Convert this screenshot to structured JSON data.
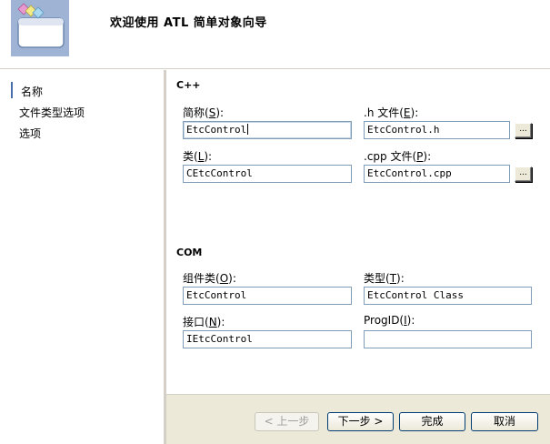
{
  "header": {
    "title": "欢迎使用 ATL 简单对象向导"
  },
  "nav": {
    "items": [
      {
        "label": "名称",
        "selected": true
      },
      {
        "label": "文件类型选项",
        "selected": false
      },
      {
        "label": "选项",
        "selected": false
      }
    ]
  },
  "cpp_group": {
    "label": "C++",
    "short_name": {
      "label_pre": "简称(",
      "hotkey": "S",
      "label_post": "):",
      "value": "EtcControl"
    },
    "h_file": {
      "label_pre": ".h 文件(",
      "hotkey": "E",
      "label_post": "):",
      "value": "EtcControl.h"
    },
    "class": {
      "label_pre": "类(",
      "hotkey": "L",
      "label_post": "):",
      "value": "CEtcControl"
    },
    "cpp_file": {
      "label_pre": ".cpp 文件(",
      "hotkey": "P",
      "label_post": "):",
      "value": "EtcControl.cpp"
    },
    "browse_label": "..."
  },
  "com_group": {
    "label": "COM",
    "coclass": {
      "label_pre": "组件类(",
      "hotkey": "O",
      "label_post": "):",
      "value": "EtcControl"
    },
    "type": {
      "label_pre": "类型(",
      "hotkey": "T",
      "label_post": "):",
      "value": "EtcControl Class"
    },
    "interface": {
      "label_pre": "接口(",
      "hotkey": "N",
      "label_post": "):",
      "value": "IEtcControl"
    },
    "progid": {
      "label_pre": "ProgID(",
      "hotkey": "I",
      "label_post": "):",
      "value": ""
    }
  },
  "buttons": {
    "back": "< 上一步",
    "next": "下一步 >",
    "finish": "完成",
    "cancel": "取消"
  },
  "colors": {
    "input_border": "#7f9db9",
    "button_border": "#003c74",
    "footer_bg": "#ece9d8"
  }
}
